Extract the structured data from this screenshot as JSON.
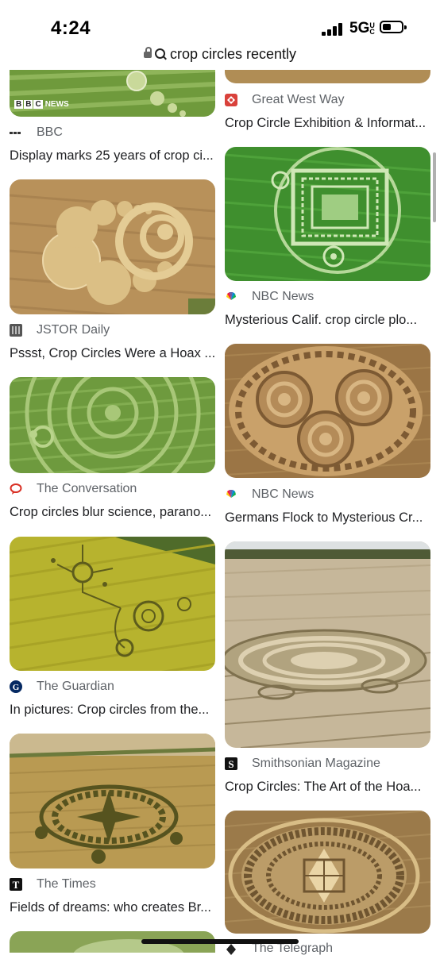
{
  "status": {
    "time": "4:24",
    "network": "5G",
    "network_suffix": "UC"
  },
  "url": {
    "query": "crop circles recently"
  },
  "left_column": [
    {
      "source": "BBC",
      "title": "Display marks 25 years of crop ci...",
      "badge": "BBC NEWS"
    },
    {
      "source": "JSTOR Daily",
      "title": "Pssst, Crop Circles Were a Hoax ..."
    },
    {
      "source": "The Conversation",
      "title": "Crop circles blur science, parano..."
    },
    {
      "source": "The Guardian",
      "title": "In pictures: Crop circles from the..."
    },
    {
      "source": "The Times",
      "title": "Fields of dreams: who creates Br..."
    }
  ],
  "right_column": [
    {
      "source": "Great West Way",
      "title": "Crop Circle Exhibition & Informat..."
    },
    {
      "source": "NBC News",
      "title": "Mysterious Calif. crop circle plo..."
    },
    {
      "source": "NBC News",
      "title": "Germans Flock to Mysterious Cr..."
    },
    {
      "source": "Smithsonian Magazine",
      "title": "Crop Circles: The Art of the Hoa..."
    },
    {
      "source": "The Telegraph",
      "title": ""
    }
  ],
  "colors": {
    "text": "#202124",
    "source": "#5f6368",
    "background": "#ffffff"
  },
  "icons": [
    "lock-icon",
    "search-icon",
    "bbc-icon",
    "jstor-icon",
    "conversation-icon",
    "guardian-icon",
    "times-icon",
    "great-west-way-icon",
    "nbc-peacock-icon",
    "smithsonian-icon",
    "telegraph-icon"
  ]
}
